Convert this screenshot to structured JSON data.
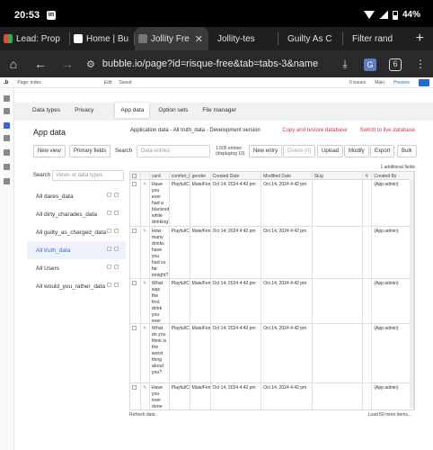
{
  "status_bar": {
    "time": "20:53",
    "notification_app": "in",
    "battery": "44%"
  },
  "tabs": [
    {
      "label": "Lead: Prop",
      "favicon_color": "#e8453c",
      "active": false
    },
    {
      "label": "Home | Bu",
      "favicon_color": "#ffffff",
      "active": false
    },
    {
      "label": "Jollity Fre",
      "favicon_color": "#555555",
      "active": true
    },
    {
      "label": "Jollity-tes",
      "favicon_color": "#444444",
      "active": false
    },
    {
      "label": "Guilty As C",
      "favicon_color": "#444444",
      "active": false
    },
    {
      "label": "Filter rand",
      "favicon_color": "#444444",
      "active": false
    }
  ],
  "url": "bubble.io/page?id=risque-free&tab=tabs-3&name",
  "tab_count": "6",
  "editor": {
    "logo": ".b",
    "page": "Page: index",
    "menu": [
      "Edit",
      "Saved"
    ],
    "issues": "0 issues",
    "branch": "Main",
    "preview": "Preview"
  },
  "subtabs": [
    "Data types",
    "Privacy",
    "App data",
    "Option sets",
    "File manager"
  ],
  "app_data": {
    "title": "App data",
    "breadcrumb": "Application data - All truth_data - Development version",
    "copy_link": "Copy and restore database",
    "switch_link": "Switch to live database",
    "new_view": "New view",
    "primary_fields": "Primary fields",
    "search_label": "Search",
    "search_placeholder": "Data entries",
    "count_line1": "1,505 entries",
    "count_line2": "(displaying 10)",
    "new_entry": "New entry",
    "delete": "Delete (0)",
    "upload": "Upload",
    "modify": "Modify",
    "export": "Export",
    "bulk": "Bulk",
    "types_search_label": "Search",
    "types_placeholder": "Views or data types",
    "additional_fields": "1 additional fields",
    "data_types": [
      {
        "name": "All dares_data",
        "selected": false
      },
      {
        "name": "All dirty_charades_data",
        "selected": false
      },
      {
        "name": "All guilty_as_charged_data",
        "selected": false
      },
      {
        "name": "All truth_data",
        "selected": true
      },
      {
        "name": "All Users",
        "selected": false
      },
      {
        "name": "All would_you_rather_data",
        "selected": false
      }
    ],
    "columns": [
      "",
      "",
      "card",
      "comfort_le",
      "gender",
      "Created Date",
      "Modified Date",
      "Slug",
      "",
      "Created By"
    ],
    "rows": [
      {
        "card": "Have you ever had a blackout while drinking?",
        "comfort": "Playful/Ch",
        "gender": "Male/Fem",
        "created": "Oct 14, 2024 4:42 pm",
        "modified": "Oct 14, 2024 4:42 pm",
        "slug": "",
        "created_by": "(App admin)"
      },
      {
        "card": "How many drinks have you had so far tonight?",
        "comfort": "Playful/Ch",
        "gender": "Male/Fem",
        "created": "Oct 14, 2024 4:42 pm",
        "modified": "Oct 14, 2024 4:42 pm",
        "slug": "",
        "created_by": "(App admin)"
      },
      {
        "card": "What was the first drink you ever had?",
        "comfort": "Playful/Ch",
        "gender": "Male/Fem",
        "created": "Oct 14, 2024 4:42 pm",
        "modified": "Oct 14, 2024 4:42 pm",
        "slug": "",
        "created_by": "(App admin)"
      },
      {
        "card": "What do you think is the worst thing about you?",
        "comfort": "Playful/Ch",
        "gender": "Male/Fem",
        "created": "Oct 14, 2024 4:42 pm",
        "modified": "Oct 14, 2024 4:42 pm",
        "slug": "",
        "created_by": "(App admin)"
      },
      {
        "card": "Have you ever done somethin",
        "comfort": "Playful/Ch",
        "gender": "Male/Fem",
        "created": "Oct 14, 2024 4:42 pm",
        "modified": "Oct 14, 2024 4:42 pm",
        "slug": "",
        "created_by": "(App admin)"
      }
    ],
    "refresh": "Refresh data",
    "load_more": "Load 50 more items..."
  }
}
